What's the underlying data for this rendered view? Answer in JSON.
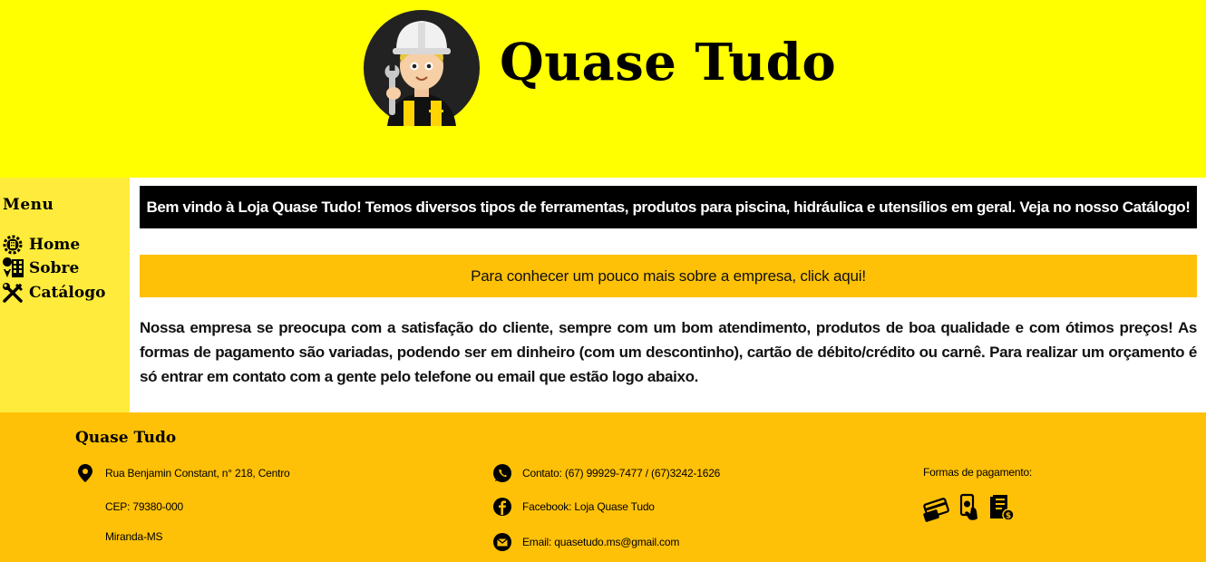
{
  "header": {
    "site_title": "Quase Tudo",
    "logo_icon": "worker-mascot-logo"
  },
  "sidebar": {
    "title": "Menu",
    "items": [
      {
        "label": "Home",
        "icon": "gear-building-icon"
      },
      {
        "label": "Sobre",
        "icon": "building-location-icon"
      },
      {
        "label": "Catálogo",
        "icon": "tools-icon"
      }
    ]
  },
  "main": {
    "welcome_text": "Bem vindo à Loja Quase Tudo! Temos diversos tipos de ferramentas, produtos para piscina, hidráulica e utensílios em geral. Veja no nosso Catálogo!",
    "about_link": "Para conhecer um pouco mais sobre a empresa, click aqui!",
    "paragraph": "Nossa empresa se preocupa com a satisfação do cliente, sempre com um bom atendimento, produtos de boa qualidade e com ótimos preços! As formas de pagamento são variadas, podendo ser em dinheiro (com um descontinho), cartão de débito/crédito ou carnê. Para realizar um orçamento é só entrar em contato com a gente pelo telefone ou email que estão logo abaixo."
  },
  "footer": {
    "brand": "Quase Tudo",
    "address": {
      "street": "Rua Benjamin Constant, n° 218, Centro",
      "cep": "CEP: 79380-000",
      "city": "Miranda-MS"
    },
    "contact": {
      "phone": "Contato: (67) 99929-7477 / (67)3242-1626",
      "facebook": "Facebook: Loja Quase Tudo",
      "email": "Email: quasetudo.ms@gmail.com"
    },
    "payment": {
      "title": "Formas de pagamento:",
      "icons": [
        "credit-card-icon",
        "mobile-payment-icon",
        "invoice-icon"
      ]
    }
  },
  "colors": {
    "header_bg": "#ffff00",
    "sidebar_bg": "#ffeb3b",
    "footer_bg": "#ffc107",
    "welcome_bg": "#000000"
  }
}
